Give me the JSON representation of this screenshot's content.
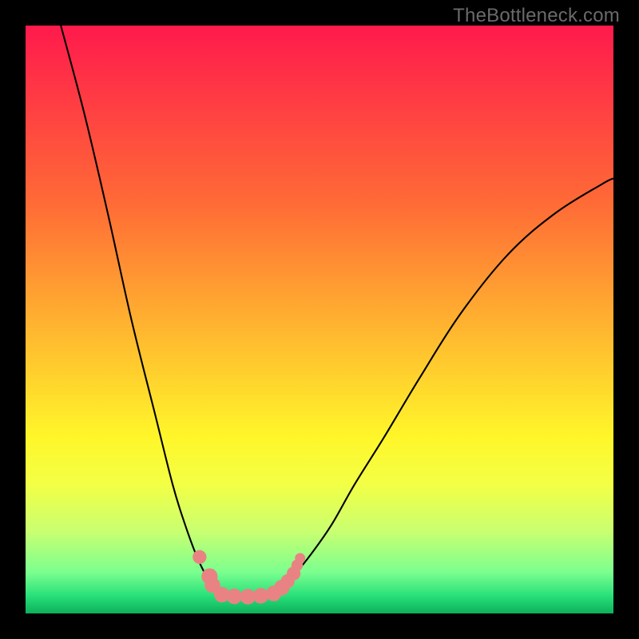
{
  "watermark": "TheBottleneck.com",
  "colors": {
    "frame": "#000000",
    "curve_stroke": "#000000",
    "marker_fill": "#e98383",
    "baseline": "#28e07a",
    "gradient_stops": [
      {
        "offset": 0.0,
        "color": "#ff1a4c"
      },
      {
        "offset": 0.12,
        "color": "#ff3a44"
      },
      {
        "offset": 0.3,
        "color": "#ff6a36"
      },
      {
        "offset": 0.5,
        "color": "#ffb030"
      },
      {
        "offset": 0.7,
        "color": "#fff62a"
      },
      {
        "offset": 0.78,
        "color": "#f3ff45"
      },
      {
        "offset": 0.86,
        "color": "#c9ff70"
      },
      {
        "offset": 0.93,
        "color": "#7bff8f"
      },
      {
        "offset": 0.97,
        "color": "#28e07a"
      },
      {
        "offset": 1.0,
        "color": "#0db05a"
      }
    ]
  },
  "chart_data": {
    "type": "line",
    "title": "",
    "xlabel": "",
    "ylabel": "",
    "xlim": [
      0,
      100
    ],
    "ylim": [
      0,
      100
    ],
    "series": [
      {
        "name": "curve-left",
        "x": [
          6.0,
          10.0,
          14.0,
          18.0,
          22.0,
          25.0,
          27.0,
          29.0,
          30.5,
          31.5,
          32.2,
          33.0,
          34.0
        ],
        "y": [
          100.0,
          85.0,
          68.0,
          50.0,
          34.0,
          22.0,
          15.5,
          10.0,
          6.8,
          5.0,
          4.2,
          3.6,
          3.2
        ]
      },
      {
        "name": "valley-floor",
        "x": [
          33.2,
          34.0,
          35.0,
          36.0,
          37.0,
          38.0,
          39.0,
          40.0,
          41.0,
          42.0,
          42.8
        ],
        "y": [
          3.2,
          3.0,
          2.9,
          2.85,
          2.82,
          2.85,
          2.9,
          3.0,
          3.15,
          3.35,
          3.6
        ]
      },
      {
        "name": "curve-right",
        "x": [
          42.8,
          44.0,
          46.0,
          48.5,
          52.0,
          56.0,
          61.0,
          67.0,
          74.0,
          82.0,
          90.0,
          98.0,
          100.0
        ],
        "y": [
          3.6,
          4.6,
          6.9,
          10.0,
          15.0,
          22.0,
          30.0,
          40.0,
          51.0,
          61.0,
          68.0,
          73.0,
          74.0
        ]
      }
    ],
    "markers": [
      {
        "x": 29.6,
        "y": 9.6,
        "r": 1.2
      },
      {
        "x": 31.3,
        "y": 6.3,
        "r": 1.4
      },
      {
        "x": 31.8,
        "y": 4.8,
        "r": 1.35
      },
      {
        "x": 33.4,
        "y": 3.2,
        "r": 1.35
      },
      {
        "x": 35.5,
        "y": 2.9,
        "r": 1.35
      },
      {
        "x": 37.8,
        "y": 2.85,
        "r": 1.35
      },
      {
        "x": 40.0,
        "y": 3.0,
        "r": 1.35
      },
      {
        "x": 42.2,
        "y": 3.4,
        "r": 1.35
      },
      {
        "x": 43.6,
        "y": 4.4,
        "r": 1.35
      },
      {
        "x": 44.6,
        "y": 5.5,
        "r": 1.2
      },
      {
        "x": 45.6,
        "y": 6.8,
        "r": 1.2
      },
      {
        "x": 46.2,
        "y": 8.2,
        "r": 1.0
      },
      {
        "x": 46.7,
        "y": 9.4,
        "r": 0.9
      }
    ]
  }
}
